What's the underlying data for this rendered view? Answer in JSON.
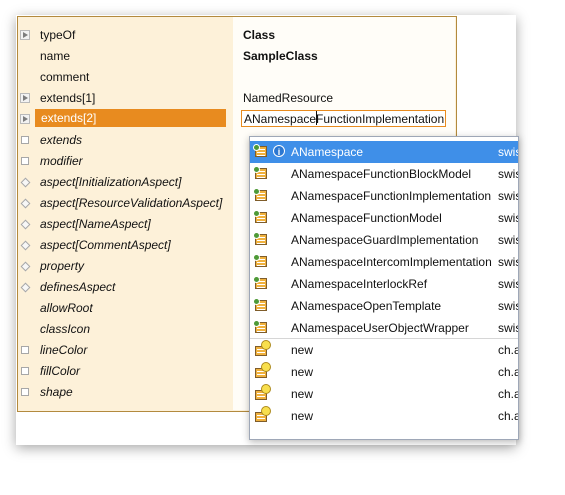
{
  "window": {
    "properties": [
      {
        "label": "typeOf",
        "value": "Class",
        "valueStyle": "bold",
        "marker": "tri-box"
      },
      {
        "label": "name",
        "value": "SampleClass",
        "valueStyle": "bold",
        "marker": "none"
      },
      {
        "label": "comment",
        "value": "",
        "valueStyle": "normal",
        "marker": "none"
      },
      {
        "label": "extends[1]",
        "value": "NamedResource",
        "valueStyle": "normal",
        "marker": "tri-box"
      },
      {
        "label": "extends[2]",
        "value": "ANamespaceFunctionImplementation",
        "valueStyle": "editor",
        "marker": "tri-box",
        "selected": true
      },
      {
        "label": "extends",
        "value": "",
        "valueStyle": "normal",
        "marker": "square",
        "italic": true
      },
      {
        "label": "modifier",
        "value": "",
        "valueStyle": "normal",
        "marker": "square",
        "italic": true
      },
      {
        "label": "aspect[InitializationAspect]",
        "value": "",
        "valueStyle": "normal",
        "marker": "diamond",
        "italic": true
      },
      {
        "label": "aspect[ResourceValidationAspect]",
        "value": "",
        "valueStyle": "normal",
        "marker": "diamond",
        "italic": true
      },
      {
        "label": "aspect[NameAspect]",
        "value": "",
        "valueStyle": "normal",
        "marker": "diamond",
        "italic": true
      },
      {
        "label": "aspect[CommentAspect]",
        "value": "",
        "valueStyle": "normal",
        "marker": "diamond",
        "italic": true
      },
      {
        "label": "property",
        "value": "",
        "valueStyle": "normal",
        "marker": "diamond",
        "italic": true
      },
      {
        "label": "definesAspect",
        "value": "",
        "valueStyle": "normal",
        "marker": "diamond",
        "italic": true
      },
      {
        "label": "allowRoot",
        "value": "",
        "valueStyle": "normal",
        "marker": "none",
        "italic": true
      },
      {
        "label": "classIcon",
        "value": "",
        "valueStyle": "normal",
        "marker": "none",
        "italic": true
      },
      {
        "label": "lineColor",
        "value": "",
        "valueStyle": "normal",
        "marker": "square",
        "italic": true
      },
      {
        "label": "fillColor",
        "value": "",
        "valueStyle": "normal",
        "marker": "square",
        "italic": true
      },
      {
        "label": "shape",
        "value": "",
        "valueStyle": "normal",
        "marker": "square",
        "italic": true
      }
    ]
  },
  "editor": {
    "before_caret": "ANamespace",
    "after_caret": "FunctionImplementation"
  },
  "completion": {
    "items": [
      {
        "name": "ANamespace",
        "source": "swis",
        "icon": "class-icon",
        "info_icon": true,
        "selected": true
      },
      {
        "name": "ANamespaceFunctionBlockModel",
        "source": "swis",
        "icon": "class-icon"
      },
      {
        "name": "ANamespaceFunctionImplementation",
        "source": "swis",
        "icon": "class-icon"
      },
      {
        "name": "ANamespaceFunctionModel",
        "source": "swis",
        "icon": "class-icon"
      },
      {
        "name": "ANamespaceGuardImplementation",
        "source": "swis",
        "icon": "class-icon"
      },
      {
        "name": "ANamespaceIntercomImplementation",
        "source": "swis",
        "icon": "class-icon"
      },
      {
        "name": "ANamespaceInterlockRef",
        "source": "swis",
        "icon": "class-icon"
      },
      {
        "name": "ANamespaceOpenTemplate",
        "source": "swis",
        "icon": "class-icon"
      },
      {
        "name": "ANamespaceUserObjectWrapper",
        "source": "swis",
        "icon": "class-icon"
      },
      {
        "name": "new",
        "source": "ch.a",
        "icon": "new-class-icon"
      },
      {
        "name": "new",
        "source": "ch.a",
        "icon": "new-class-icon"
      },
      {
        "name": "new",
        "source": "ch.a",
        "icon": "new-class-icon"
      },
      {
        "name": "new",
        "source": "ch.a",
        "icon": "new-class-icon"
      }
    ]
  },
  "colors": {
    "selection_orange": "#e88b1f",
    "selection_blue": "#3f8fe8",
    "panel_bg": "#fdf1d9"
  }
}
